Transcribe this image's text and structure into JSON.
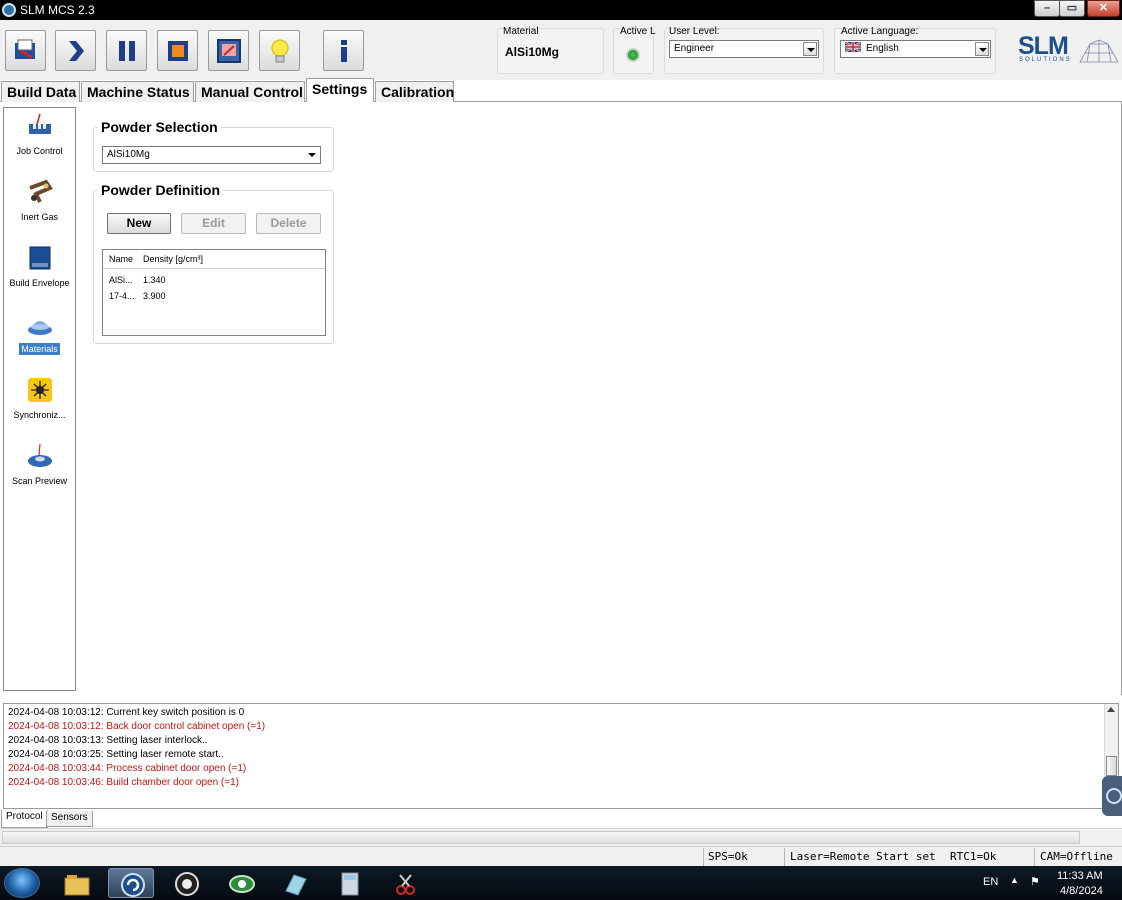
{
  "window": {
    "title": "SLM MCS 2.3",
    "controls": {
      "minimize": "–",
      "maximize": "▭",
      "close": "✕"
    }
  },
  "toolbar": {
    "buttons": [
      {
        "name": "open-job",
        "icon": "open-folder-icon"
      },
      {
        "name": "start",
        "icon": "play-arrow-icon"
      },
      {
        "name": "pause",
        "icon": "pause-icon"
      },
      {
        "name": "stop",
        "icon": "stop-icon"
      },
      {
        "name": "monitor",
        "icon": "window-icon"
      },
      {
        "name": "light",
        "icon": "light-bulb-icon"
      },
      {
        "name": "info",
        "icon": "info-icon"
      }
    ],
    "material_label": "Material",
    "material_value": "AlSi10Mg",
    "active_label": "Active L",
    "user_level_label": "User Level:",
    "user_level_value": "Engineer",
    "language_label": "Active Language:",
    "language_value": "English",
    "logo": {
      "text": "SLM",
      "sub": "SOLUTIONS"
    }
  },
  "tabs": [
    "Build Data",
    "Machine Status",
    "Manual Control",
    "Settings",
    "Calibration"
  ],
  "active_tab": "Settings",
  "sidebar": {
    "items": [
      {
        "label": "Job Control",
        "icon": "job-control-icon"
      },
      {
        "label": "Inert Gas",
        "icon": "inert-gas-icon"
      },
      {
        "label": "Build Envelope",
        "icon": "build-envelope-icon"
      },
      {
        "label": "Materials",
        "icon": "materials-icon"
      },
      {
        "label": "Synchroniz...",
        "icon": "synchronize-icon"
      },
      {
        "label": "Scan Preview",
        "icon": "scan-preview-icon"
      }
    ],
    "selected": "Materials"
  },
  "powder_selection": {
    "title": "Powder Selection",
    "value": "AlSi10Mg"
  },
  "powder_definition": {
    "title": "Powder Definition",
    "buttons": {
      "new": "New",
      "edit": "Edit",
      "delete": "Delete"
    },
    "columns": [
      "Name",
      "Density [g/cm³]"
    ],
    "rows": [
      [
        "AlSi...",
        "1.340"
      ],
      [
        "17-4...",
        "3.900"
      ]
    ]
  },
  "log": {
    "lines": [
      {
        "text": "2024-04-08 10:03:12: Current key switch position is 0",
        "level": "info"
      },
      {
        "text": "2024-04-08 10:03:12: Back door control cabinet open (=1)",
        "level": "error"
      },
      {
        "text": "2024-04-08 10:03:13: Setting laser interlock..",
        "level": "info"
      },
      {
        "text": "2024-04-08 10:03:25: Setting laser remote start..",
        "level": "info"
      },
      {
        "text": "2024-04-08 10:03:44: Process cabinet door open (=1)",
        "level": "error"
      },
      {
        "text": "2024-04-08 10:03:46: Build chamber door open (=1)",
        "level": "error"
      }
    ],
    "colors": {
      "info": "#000000",
      "error": "#c4150f"
    }
  },
  "bottom_tabs": [
    "Protocol",
    "Sensors"
  ],
  "status": {
    "sps": "SPS=Ok",
    "laser": "Laser=Remote Start set",
    "rtc": "RTC1=Ok",
    "cam": "CAM=Offline"
  },
  "taskbar": {
    "apps": [
      "explorer-icon",
      "slm-mcs-icon",
      "camera-icon",
      "eye-icon",
      "notepad-icon",
      "calculator-icon",
      "snipping-tool-icon"
    ],
    "language": "EN",
    "time": "11:33 AM",
    "date": "4/8/2024"
  }
}
